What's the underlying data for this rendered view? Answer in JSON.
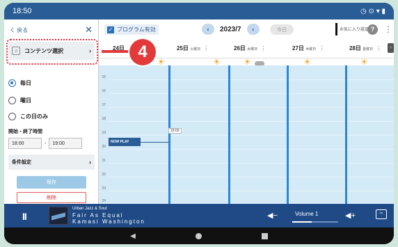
{
  "status": {
    "time": "18:50",
    "icons": "◷ ⊙ ▾ ▮"
  },
  "sidebar": {
    "back_label": "く 戻る",
    "close": "✕",
    "content_select": "コンテンツ選択",
    "radio": [
      "毎日",
      "曜日",
      "この日のみ"
    ],
    "time_label": "開始・終了時間",
    "start_time": "18:00",
    "dash": "-",
    "end_time": "19:00",
    "condition": "条件設定",
    "save": "保存",
    "delete": "削除"
  },
  "topbar": {
    "program_checkbox": "プログラム有効",
    "month": "2023/7",
    "prev": "‹",
    "next": "›",
    "today": "今日",
    "recent": "お気に入り設定",
    "help": "?",
    "menu": "⋮"
  },
  "days": [
    {
      "label": "24日",
      "dow": "月曜日"
    },
    {
      "label": "25日",
      "dow": "火曜日"
    },
    {
      "label": "26日",
      "dow": "水曜日"
    },
    {
      "label": "27日",
      "dow": "木曜日"
    },
    {
      "label": "28日",
      "dow": "金曜日"
    }
  ],
  "grid": {
    "hour_ticks": [
      "15",
      "16",
      "17",
      "18",
      "19",
      "20",
      "21",
      "22",
      "23",
      "24"
    ],
    "now_play": "NOW PLAY",
    "time_marker": "18:00"
  },
  "callout": {
    "number": "4"
  },
  "player": {
    "pause": "II",
    "genre": "Urban Jazz & Soul",
    "title": "Fair As Equal",
    "artist": "Kamasi Washington",
    "volume_label": "Volume 1",
    "vol_down": "◀−",
    "vol_up": "◀+",
    "cast": "⇨"
  },
  "navbar": {
    "back": "◀"
  }
}
